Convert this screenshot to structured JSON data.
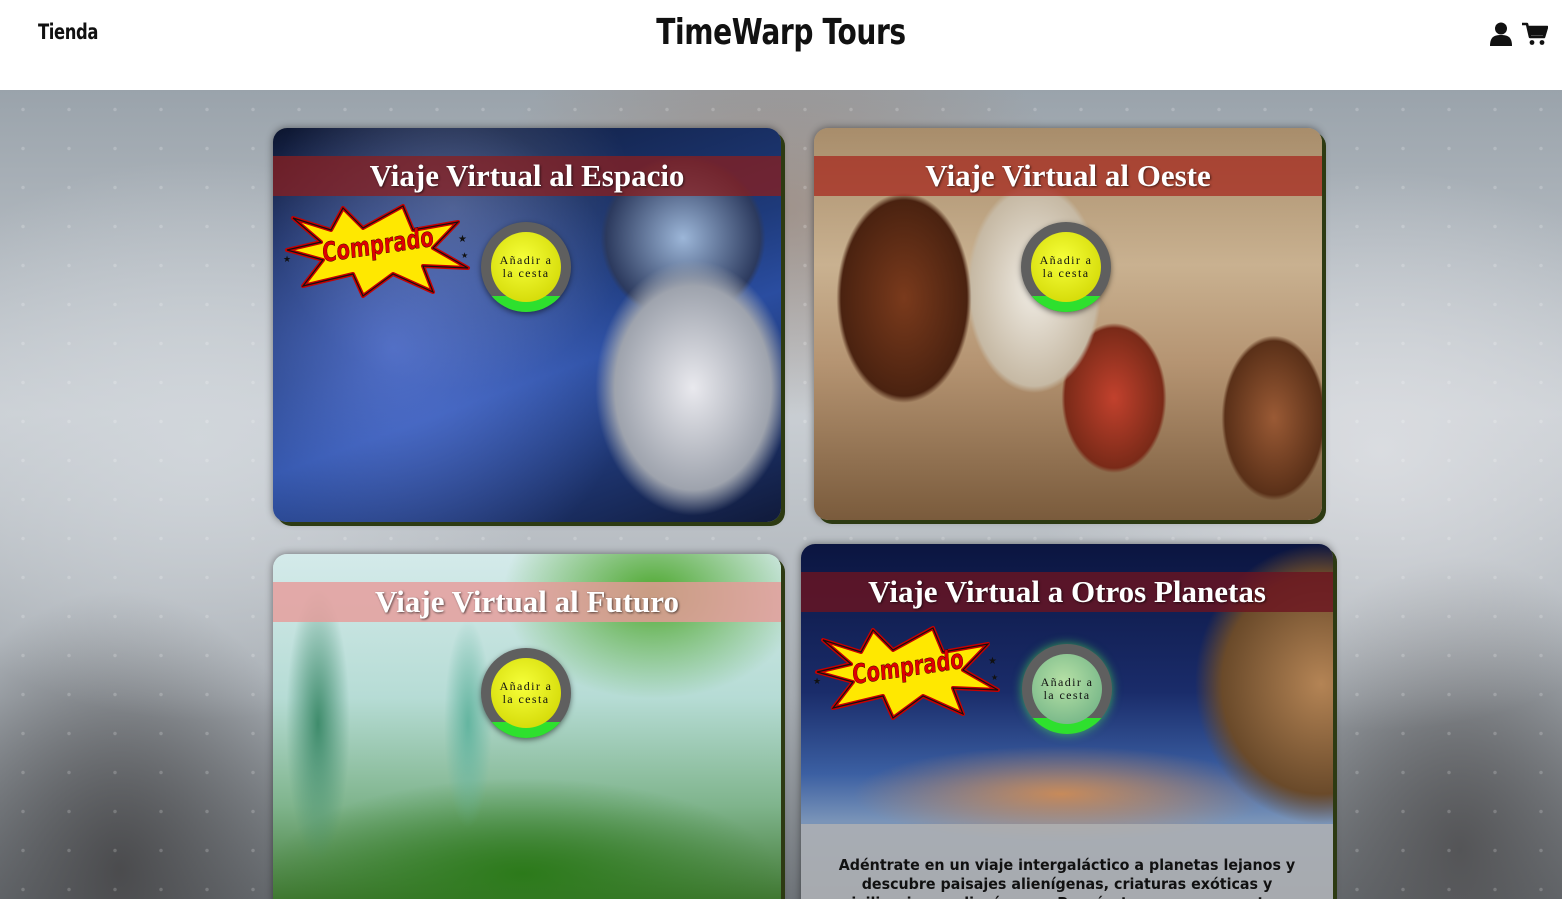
{
  "header": {
    "nav_link": "Tienda",
    "brand": "TimeWarp Tours",
    "icons": [
      "user-icon",
      "cart-icon"
    ]
  },
  "products": [
    {
      "title": "Viaje Virtual al Espacio",
      "badge": "Comprado",
      "button_label": "Añadir a la cesta",
      "purchased": true
    },
    {
      "title": "Viaje Virtual al Oeste",
      "badge": "",
      "button_label": "Añadir a la cesta",
      "purchased": false
    },
    {
      "title": "Viaje Virtual al Futuro",
      "badge": "",
      "button_label": "Añadir a la cesta",
      "purchased": false
    },
    {
      "title": "Viaje Virtual a Otros Planetas",
      "badge": "Comprado",
      "button_label": "Añadir a la cesta",
      "purchased": true,
      "description": "Adéntrate en un viaje intergaláctico a planetas lejanos y descubre paisajes alienígenas, criaturas exóticas y civilizaciones alienígenas. Prepárate para una aventura única en el universo"
    }
  ],
  "colors": {
    "title_band_space": "#8a1f1f",
    "title_band_west": "#a52a1f",
    "title_band_future": "#e79a98",
    "title_band_planets": "#6b1420",
    "button_fill": "#2ee02e",
    "badge_red": "#e00000",
    "badge_yellow": "#ffe800"
  }
}
